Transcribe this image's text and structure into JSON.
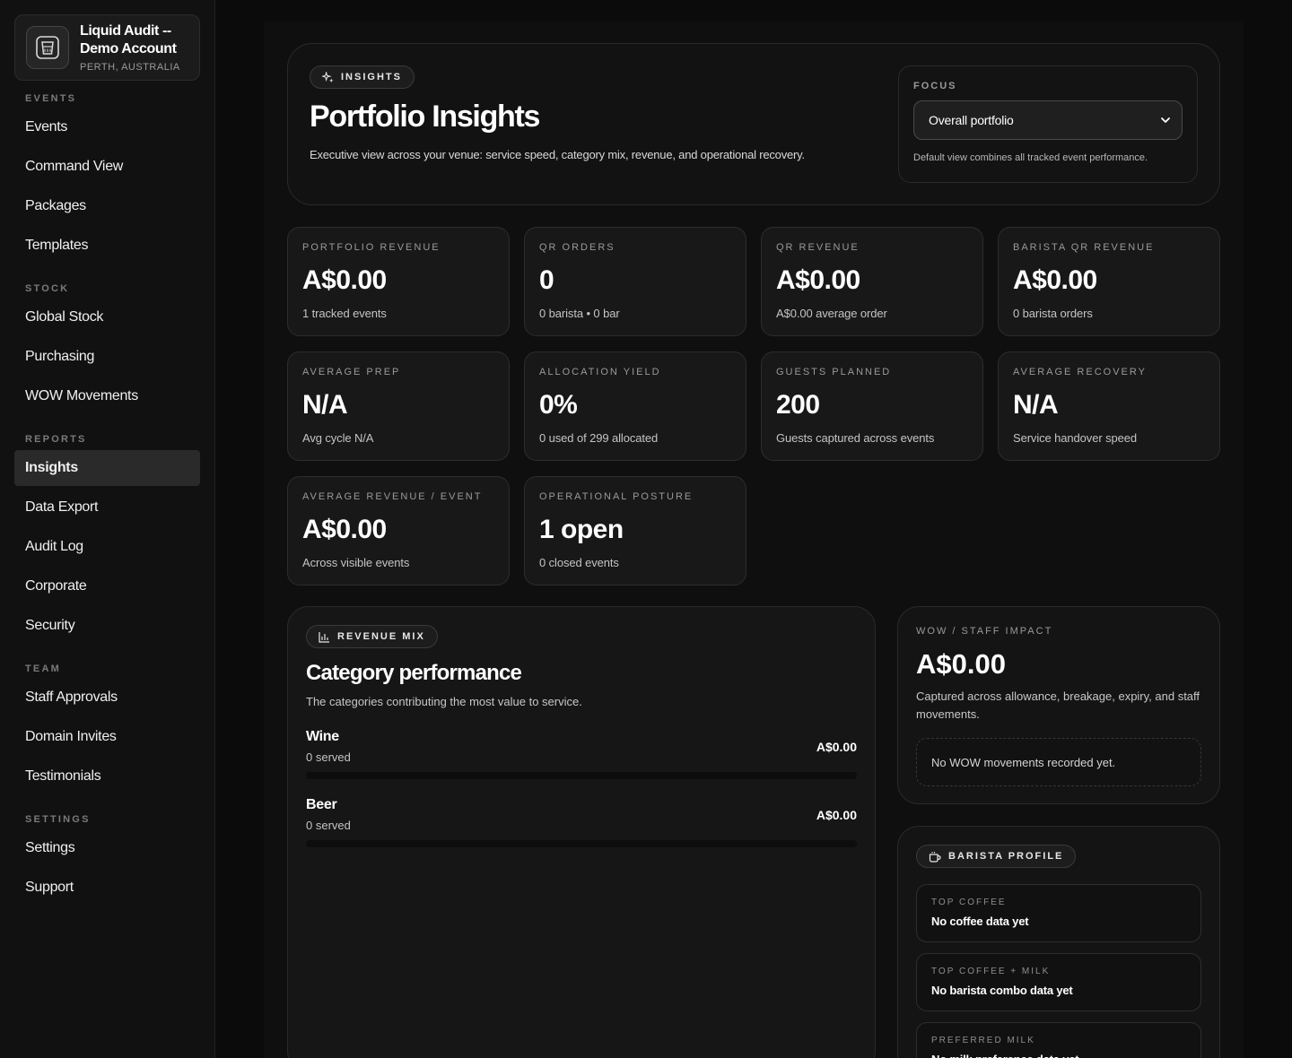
{
  "account": {
    "name": "Liquid Audit -- Demo Account",
    "location": "PERTH, AUSTRALIA"
  },
  "sidebar": {
    "sections": [
      {
        "title": "EVENTS",
        "items": [
          "Events",
          "Command View",
          "Packages",
          "Templates"
        ]
      },
      {
        "title": "STOCK",
        "items": [
          "Global Stock",
          "Purchasing",
          "WOW Movements"
        ]
      },
      {
        "title": "REPORTS",
        "items": [
          "Insights",
          "Data Export",
          "Audit Log",
          "Corporate",
          "Security"
        ]
      },
      {
        "title": "TEAM",
        "items": [
          "Staff Approvals",
          "Domain Invites",
          "Testimonials"
        ]
      },
      {
        "title": "SETTINGS",
        "items": [
          "Settings",
          "Support"
        ]
      }
    ],
    "active": "Insights"
  },
  "hero": {
    "badge": "INSIGHTS",
    "title": "Portfolio Insights",
    "subtitle": "Executive view across your venue: service speed, category mix, revenue, and operational recovery.",
    "focus": {
      "label": "FOCUS",
      "selected": "Overall portfolio",
      "hint": "Default view combines all tracked event performance."
    }
  },
  "stats": [
    {
      "label": "PORTFOLIO REVENUE",
      "value": "A$0.00",
      "note": "1 tracked events"
    },
    {
      "label": "QR ORDERS",
      "value": "0",
      "note": "0 barista • 0 bar"
    },
    {
      "label": "QR REVENUE",
      "value": "A$0.00",
      "note": "A$0.00 average order"
    },
    {
      "label": "BARISTA QR REVENUE",
      "value": "A$0.00",
      "note": "0 barista orders"
    },
    {
      "label": "AVERAGE PREP",
      "value": "N/A",
      "note": "Avg cycle N/A"
    },
    {
      "label": "ALLOCATION YIELD",
      "value": "0%",
      "note": "0 used of 299 allocated"
    },
    {
      "label": "GUESTS PLANNED",
      "value": "200",
      "note": "Guests captured across events"
    },
    {
      "label": "AVERAGE RECOVERY",
      "value": "N/A",
      "note": "Service handover speed"
    },
    {
      "label": "AVERAGE REVENUE / EVENT",
      "value": "A$0.00",
      "note": "Across visible events"
    },
    {
      "label": "OPERATIONAL POSTURE",
      "value": "1 open",
      "note": "0 closed events"
    }
  ],
  "revenue_mix": {
    "badge": "REVENUE MIX",
    "title": "Category performance",
    "subtitle": "The categories contributing the most value to service.",
    "categories": [
      {
        "name": "Wine",
        "served": "0 served",
        "amount": "A$0.00",
        "share": 0
      },
      {
        "name": "Beer",
        "served": "0 served",
        "amount": "A$0.00",
        "share": 0
      }
    ]
  },
  "wow": {
    "label": "WOW / STAFF IMPACT",
    "value": "A$0.00",
    "description": "Captured across allowance, breakage, expiry, and staff movements.",
    "empty": "No WOW movements recorded yet."
  },
  "barista_profile": {
    "badge": "BARISTA PROFILE",
    "items": [
      {
        "label": "TOP COFFEE",
        "value": "No coffee data yet"
      },
      {
        "label": "TOP COFFEE + MILK",
        "value": "No barista combo data yet"
      },
      {
        "label": "PREFERRED MILK",
        "value": "No milk preference data yet"
      }
    ]
  }
}
